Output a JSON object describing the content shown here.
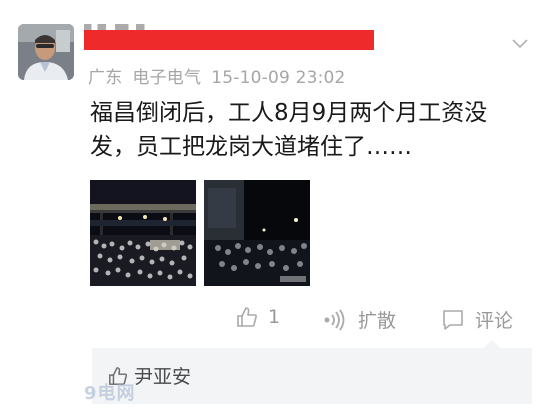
{
  "post": {
    "location": "广东",
    "source": "电子电气",
    "timestamp": "15-10-09 23:02",
    "text": "福昌倒闭后，工人8月9月两个月工资没发，员工把龙岗大道堵住了……"
  },
  "icons": {
    "avatar": "user-avatar",
    "menu": "chevron-down-icon",
    "like": "thumbs-up-icon",
    "share": "broadcast-icon",
    "comment": "speech-bubble-icon"
  },
  "actions": {
    "like_count": "1",
    "share_label": "扩散",
    "comment_label": "评论"
  },
  "likes": {
    "names": "尹亚安"
  },
  "watermark": "9电网",
  "colors": {
    "redaction": "#ee2a2a",
    "meta_gray": "#a6a6a6",
    "comment_bg": "#f3f4f6"
  }
}
